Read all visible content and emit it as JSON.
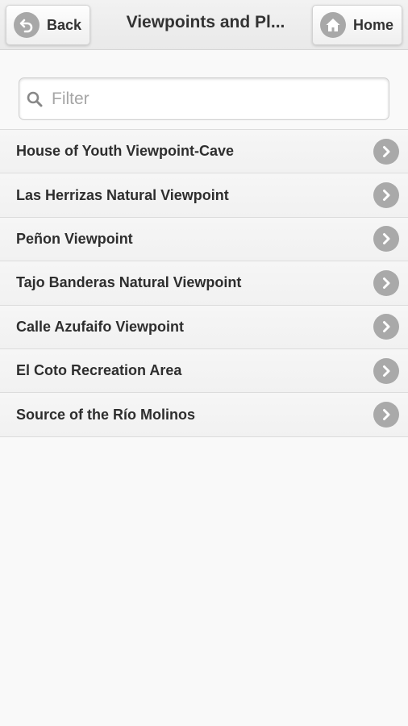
{
  "header": {
    "back_label": "Back",
    "title": "Viewpoints and Pl...",
    "home_label": "Home"
  },
  "filter": {
    "placeholder": "Filter",
    "value": ""
  },
  "list": {
    "items": [
      {
        "label": "House of Youth Viewpoint-Cave"
      },
      {
        "label": "Las Herrizas Natural Viewpoint"
      },
      {
        "label": "Peñon Viewpoint"
      },
      {
        "label": "Tajo Banderas Natural Viewpoint"
      },
      {
        "label": "Calle Azufaifo Viewpoint"
      },
      {
        "label": "El Coto Recreation Area"
      },
      {
        "label": "Source of the Río Molinos"
      }
    ]
  },
  "icons": {
    "back": "back-arrow-icon",
    "home": "home-icon",
    "search": "search-icon",
    "row_chevron": "chevron-right-icon"
  },
  "colors": {
    "icon_disc": "#a8a8a8",
    "text": "#333333",
    "placeholder": "#a6a6a6"
  }
}
